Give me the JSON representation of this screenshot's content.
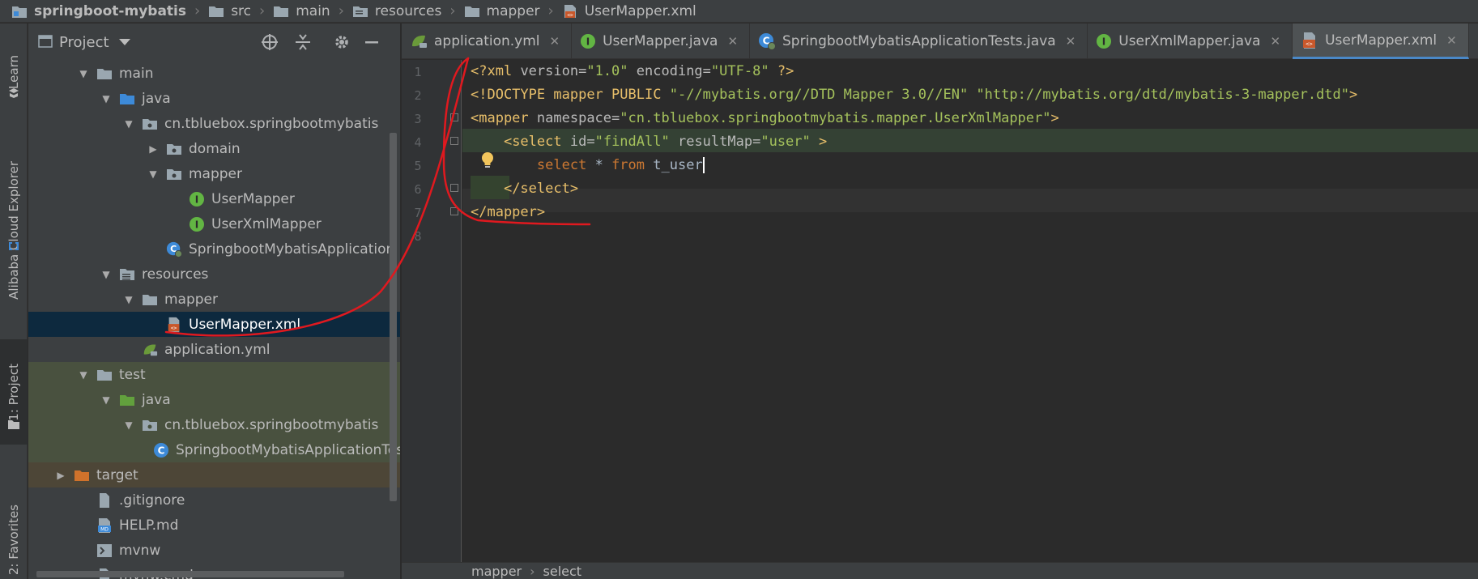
{
  "breadcrumb": [
    "springboot-mybatis",
    "src",
    "main",
    "resources",
    "mapper",
    "UserMapper.xml"
  ],
  "tool_strip": {
    "learn": "Learn",
    "cloud_explorer": "Alibaba Cloud Explorer",
    "project": "1: Project",
    "favorites": "2: Favorites"
  },
  "project_panel": {
    "title": "Project",
    "tree": [
      {
        "label": "main",
        "icon": "folder-icon"
      },
      {
        "label": "java",
        "icon": "source-folder-icon"
      },
      {
        "label": "cn.tbluebox.springbootmybatis",
        "icon": "package-icon"
      },
      {
        "label": "domain",
        "icon": "package-icon"
      },
      {
        "label": "mapper",
        "icon": "package-icon"
      },
      {
        "label": "UserMapper",
        "icon": "interface-icon"
      },
      {
        "label": "UserXmlMapper",
        "icon": "interface-icon"
      },
      {
        "label": "SpringbootMybatisApplication",
        "icon": "spring-boot-class-icon"
      },
      {
        "label": "resources",
        "icon": "resources-folder-icon"
      },
      {
        "label": "mapper",
        "icon": "folder-icon"
      },
      {
        "label": "UserMapper.xml",
        "icon": "mybatis-xml-icon"
      },
      {
        "label": "application.yml",
        "icon": "spring-yml-icon"
      },
      {
        "label": "test",
        "icon": "folder-icon"
      },
      {
        "label": "java",
        "icon": "test-source-folder-icon"
      },
      {
        "label": "cn.tbluebox.springbootmybatis",
        "icon": "package-icon"
      },
      {
        "label": "SpringbootMybatisApplicationTests",
        "icon": "test-class-icon"
      },
      {
        "label": "target",
        "icon": "excluded-folder-icon"
      },
      {
        "label": ".gitignore",
        "icon": "file-icon"
      },
      {
        "label": "HELP.md",
        "icon": "markdown-icon"
      },
      {
        "label": "mvnw",
        "icon": "shell-icon"
      },
      {
        "label": "mvnw.cmd",
        "icon": "file-icon"
      }
    ]
  },
  "tabs": [
    {
      "label": "application.yml",
      "icon": "spring-yml-icon",
      "active": false
    },
    {
      "label": "UserMapper.java",
      "icon": "interface-icon",
      "active": false
    },
    {
      "label": "SpringbootMybatisApplicationTests.java",
      "icon": "test-class-icon",
      "active": false
    },
    {
      "label": "UserXmlMapper.java",
      "icon": "interface-icon",
      "active": false
    },
    {
      "label": "UserMapper.xml",
      "icon": "mybatis-xml-icon",
      "active": true
    }
  ],
  "tab_close_glyph": "✕",
  "editor": {
    "line_numbers": [
      "1",
      "2",
      "3",
      "4",
      "5",
      "6",
      "7",
      "8"
    ],
    "lines": [
      "<?xml version=\"1.0\" encoding=\"UTF-8\" ?>",
      "<!DOCTYPE mapper PUBLIC \"-//mybatis.org//DTD Mapper 3.0//EN\" \"http://mybatis.org/dtd/mybatis-3-mapper.dtd\">",
      "<mapper namespace=\"cn.tbluebox.springbootmybatis.mapper.UserXmlMapper\">",
      "    <select id=\"findAll\" resultMap=\"user\" >",
      "        select * from t_user",
      "    </select>",
      "</mapper>",
      ""
    ]
  },
  "bottom_breadcrumb": [
    "mapper",
    "select"
  ],
  "colors": {
    "annotation": "#e0191f",
    "xml_tag": "#e8bf6a",
    "attr_value": "#a5c25c",
    "sql_keyword": "#cc7832",
    "selection": "#0d293e",
    "active_tab_underline": "#4a88c7"
  }
}
